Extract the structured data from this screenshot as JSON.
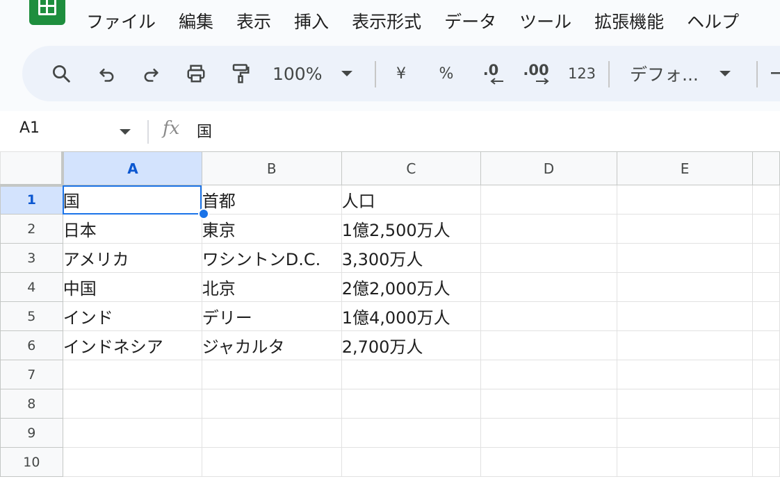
{
  "menu": [
    "ファイル",
    "編集",
    "表示",
    "挿入",
    "表示形式",
    "データ",
    "ツール",
    "拡張機能",
    "ヘルプ"
  ],
  "toolbar": {
    "zoom": "100%",
    "currency": "¥",
    "percent": "%",
    "decrease_decimal": ".0",
    "increase_decimal": ".00",
    "number_format": "123",
    "font": "デフォ..."
  },
  "formula_bar": {
    "cell_ref": "A1",
    "fx_label": "fx",
    "value": "国"
  },
  "columns": [
    "A",
    "B",
    "C",
    "D",
    "E"
  ],
  "rows": [
    {
      "n": "1",
      "cells": [
        "国",
        "首都",
        "人口",
        "",
        ""
      ]
    },
    {
      "n": "2",
      "cells": [
        "日本",
        "東京",
        "1億2,500万人",
        "",
        ""
      ]
    },
    {
      "n": "3",
      "cells": [
        "アメリカ",
        "ワシントンD.C.",
        "3,300万人",
        "",
        ""
      ]
    },
    {
      "n": "4",
      "cells": [
        "中国",
        "北京",
        "2億2,000万人",
        "",
        ""
      ]
    },
    {
      "n": "5",
      "cells": [
        "インド",
        "デリー",
        "1億4,000万人",
        "",
        ""
      ]
    },
    {
      "n": "6",
      "cells": [
        "インドネシア",
        "ジャカルタ",
        "2,700万人",
        "",
        ""
      ]
    },
    {
      "n": "7",
      "cells": [
        "",
        "",
        "",
        "",
        ""
      ]
    },
    {
      "n": "8",
      "cells": [
        "",
        "",
        "",
        "",
        ""
      ]
    },
    {
      "n": "9",
      "cells": [
        "",
        "",
        "",
        "",
        ""
      ]
    },
    {
      "n": "10",
      "cells": [
        "",
        "",
        "",
        "",
        ""
      ]
    }
  ],
  "selection": {
    "row": 0,
    "col": 0
  },
  "colors": {
    "accent": "#1a73e8",
    "logo": "#1e8e3e",
    "toolbar_bg": "#edf2fa",
    "header_active": "#d3e3fd"
  }
}
